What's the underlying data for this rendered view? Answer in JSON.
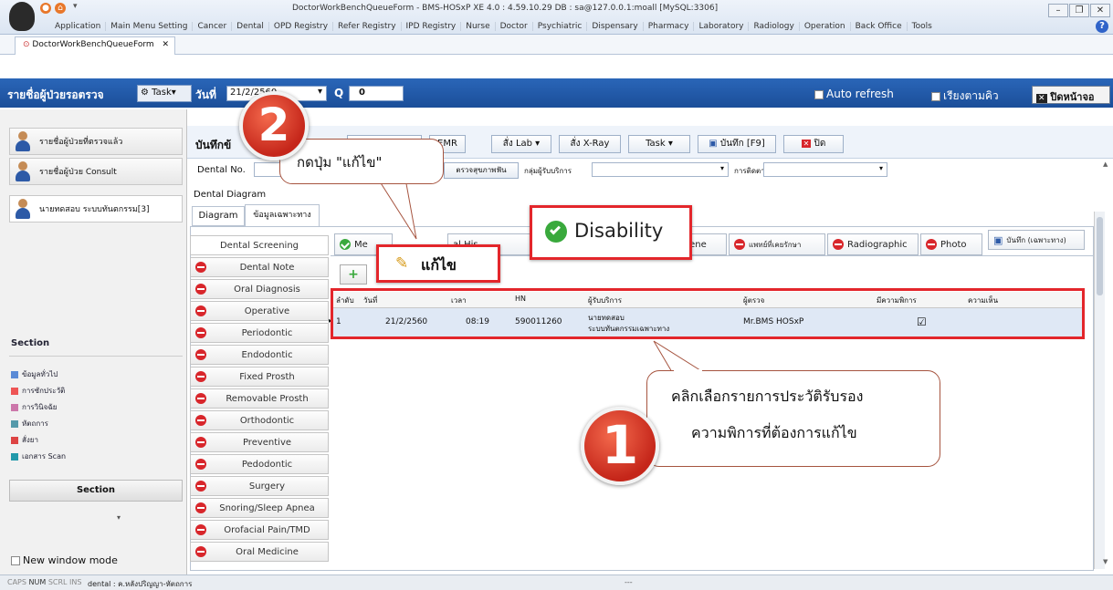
{
  "window": {
    "title": "DoctorWorkBenchQueueForm - BMS-HOSxP XE 4.0 : 4.59.10.29 DB : sa@127.0.0.1:moall [MySQL:3306]",
    "menu": [
      "Application",
      "Main Menu Setting",
      "Cancer",
      "Dental",
      "OPD Registry",
      "Refer Registry",
      "IPD Registry",
      "Nurse",
      "Doctor",
      "Psychiatric",
      "Dispensary",
      "Pharmacy",
      "Laboratory",
      "Radiology",
      "Operation",
      "Back Office",
      "Tools"
    ],
    "doc_tab": "DoctorWorkBenchQueueForm"
  },
  "queue_bar": {
    "title": "รายชื่อผู้ป่วยรอตรวจ",
    "task": "Task",
    "date_label": "วันที่",
    "date_value": "21/2/2560",
    "q_label": "Q",
    "q_value": "0",
    "auto_refresh": "Auto refresh",
    "sort_queue": "เรียงตามคิว",
    "close_screen": "ปิดหน้าจอ"
  },
  "left_nav": {
    "items": [
      "รายชื่อผู้ป่วยที่ตรวจแล้ว",
      "รายชื่อผู้ป่วย Consult",
      "นายทดสอบ ระบบทันตกรรม[3]"
    ],
    "section_title": "Section",
    "section_links": [
      "ข้อมูลทั่วไป",
      "การซักประวัติ",
      "การวินิจฉัย",
      "หัตถการ",
      "สั่งยา",
      "เอกสาร Scan"
    ],
    "section_button": "Section",
    "new_window_mode": "New window mode"
  },
  "toolbar": {
    "record_prefix": "บันทึกข้",
    "emr": "EMR",
    "order_lab": "สั่ง Lab",
    "order_xray": "สั่ง X-Ray",
    "task": "Task",
    "save": "บันทึก [F9]",
    "close": "ปิด"
  },
  "dental_row": {
    "dental_no_label": "Dental No.",
    "exam_button": "ตรวจสุขภาพฟัน",
    "service_group_label": "กลุ่มผู้รับบริการ",
    "followup_label": "การติดตาม"
  },
  "tabs": {
    "dental_diagram": "Dental Diagram",
    "diagram": "Diagram",
    "specific_info": "ข้อมูลเฉพาะทาง"
  },
  "screening": [
    "Dental Screening",
    "Dental Note",
    "Oral Diagnosis",
    "Operative",
    "Periodontic",
    "Endodontic",
    "Fixed Prosth",
    "Removable Prosth",
    "Orthodontic",
    "Preventive",
    "Pedodontic",
    "Surgery",
    "Snoring/Sleep Apnea",
    "Orofacial Pain/TMD",
    "Oral Medicine"
  ],
  "inner_tabs": {
    "medical": "Me",
    "dental_history": "al His",
    "hygiene": "giene",
    "dentist": "แพทย์ที่เคยรักษา",
    "radiographic": "Radiographic",
    "photo": "Photo",
    "save_specific": "บันทึก (เฉพาะทาง)"
  },
  "disability_tab": "Disability",
  "edit_button": "แก้ไข",
  "add_button_fragment": "+",
  "grid": {
    "headers": [
      "ลำดับ",
      "วันที่",
      "เวลา",
      "HN",
      "ผู้รับบริการ",
      "ผู้ตรวจ",
      "มีความพิการ",
      "ความเห็น"
    ],
    "row": {
      "no": "1",
      "date": "21/2/2560",
      "time": "08:19",
      "hn": "590011260",
      "patient_line1": "นายทดสอบ",
      "patient_line2": "ระบบทันตกรรมเฉพาะทาง",
      "examiner": "Mr.BMS HOSxP",
      "has_disability": "☑",
      "comment": ""
    }
  },
  "annotations": {
    "step1_number": "1",
    "step1_text_line1": "คลิกเลือกรายการประวัติรับรอง",
    "step1_text_line2": "ความพิการที่ต้องการแก้ไข",
    "step2_number": "2",
    "step2_text": "กดปุ่ม \"แก้ไข\""
  },
  "status": {
    "caps": "CAPS",
    "num": "NUM",
    "scrl": "SCRL",
    "ins": "INS",
    "info": "dental : ค.หลังปริญญา-หัตถการ",
    "extra": "---"
  },
  "colors": {
    "accent": "#1b4e99",
    "highlight": "#e3262b",
    "callout_border": "#a6543f",
    "selected_row": "#dfe8f5"
  }
}
